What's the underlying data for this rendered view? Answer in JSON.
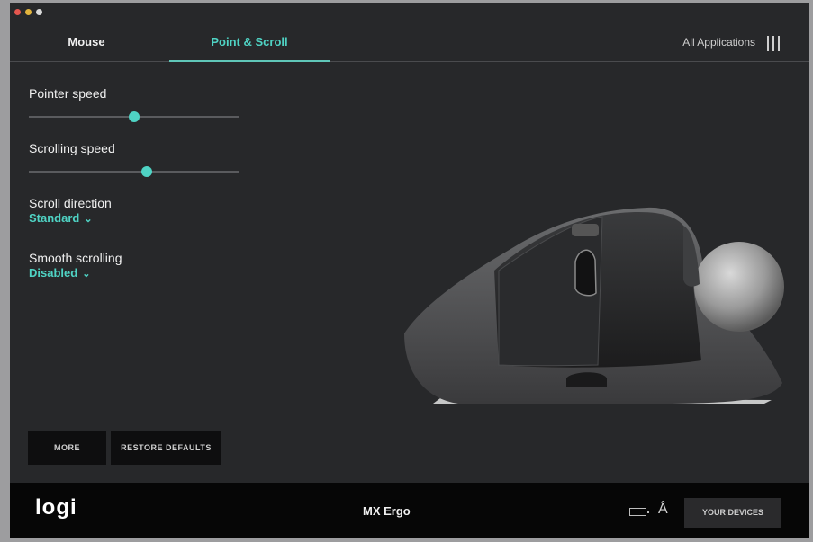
{
  "tabs": [
    {
      "label": "Mouse"
    },
    {
      "label": "Point & Scroll"
    }
  ],
  "header": {
    "apps_label": "All Applications"
  },
  "settings": {
    "pointer_speed": {
      "label": "Pointer speed",
      "value": 0.5
    },
    "scrolling_speed": {
      "label": "Scrolling speed",
      "value": 0.56
    },
    "scroll_direction": {
      "label": "Scroll direction",
      "value": "Standard"
    },
    "smooth_scrolling": {
      "label": "Smooth scrolling",
      "value": "Disabled"
    }
  },
  "buttons": {
    "more": "MORE",
    "restore": "RESTORE DEFAULTS"
  },
  "footer": {
    "logo": "logi",
    "device": "MX Ergo",
    "devices_button": "YOUR DEVICES"
  },
  "colors": {
    "accent": "#4fd3c4",
    "background": "#27282a",
    "footer": "#060606"
  }
}
